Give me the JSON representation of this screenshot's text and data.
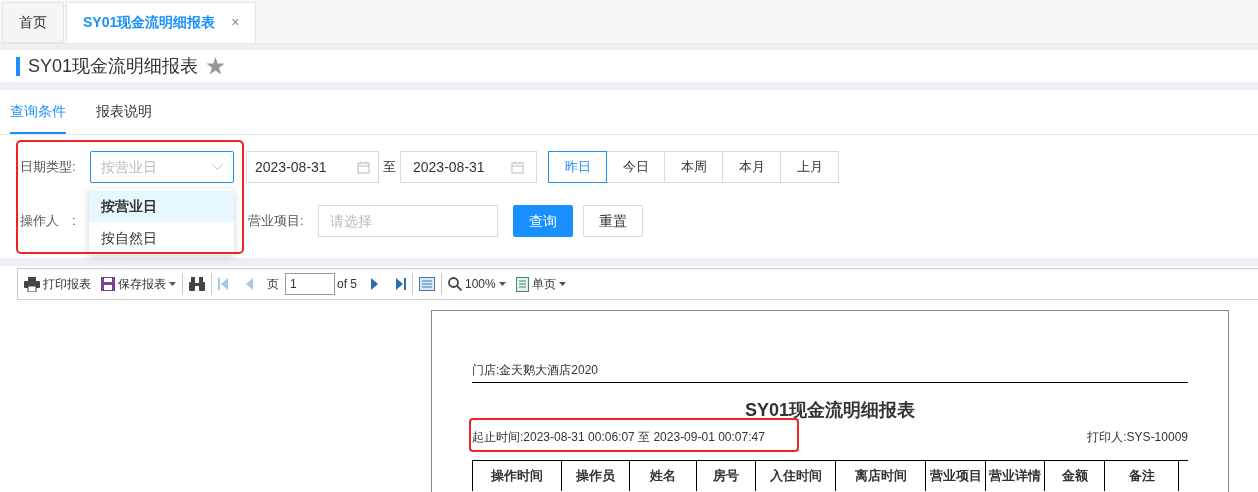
{
  "tabs": [
    {
      "label": "首页",
      "selected": false
    },
    {
      "label": "SY01现金流明细报表",
      "selected": true,
      "close": "×"
    }
  ],
  "page_title": {
    "text": "SY01现金流明细报表",
    "favorite": false
  },
  "sub_tabs": [
    {
      "label": "查询条件",
      "selected": true
    },
    {
      "label": "报表说明",
      "selected": false
    }
  ],
  "filters": {
    "date_type": {
      "label": "日期类型:",
      "placeholder": "按营业日",
      "highlighted": true,
      "options": [
        {
          "label": "按营业日",
          "selected": true
        },
        {
          "label": "按自然日",
          "selected": false
        }
      ]
    },
    "start_date": "2023-08-31",
    "separator": "至",
    "end_date": "2023-08-31",
    "quick_dates": [
      {
        "label": "昨日",
        "selected": true
      },
      {
        "label": "今日",
        "selected": false
      },
      {
        "label": "本周",
        "selected": false
      },
      {
        "label": "本月",
        "selected": false
      },
      {
        "label": "上月",
        "selected": false
      }
    ],
    "operator_label": "操作人　:",
    "project": {
      "label": "营业项目:",
      "placeholder": "请选择"
    },
    "buttons": [
      {
        "label": "查询",
        "kind": "primary"
      },
      {
        "label": "重置",
        "kind": "default"
      }
    ]
  },
  "toolbar": {
    "print": "打印报表",
    "save": "保存报表",
    "page_label": "页",
    "page": "1",
    "page_count": "of 5",
    "zoom": "100%",
    "view": "单页"
  },
  "report": {
    "store": "门店:金天鹅大酒店2020",
    "title": "SY01现金流明细报表",
    "time_range": "起止时间:2023-08-31 00:06:07 至 2023-09-01 00:07:47",
    "time_range_highlighted": true,
    "printer": "打印人:SYS-10009",
    "columns": [
      "操作时间",
      "操作员",
      "姓名",
      "房号",
      "入住时间",
      "离店时间",
      "营业项目",
      "营业详情",
      "金额",
      "备注"
    ]
  }
}
